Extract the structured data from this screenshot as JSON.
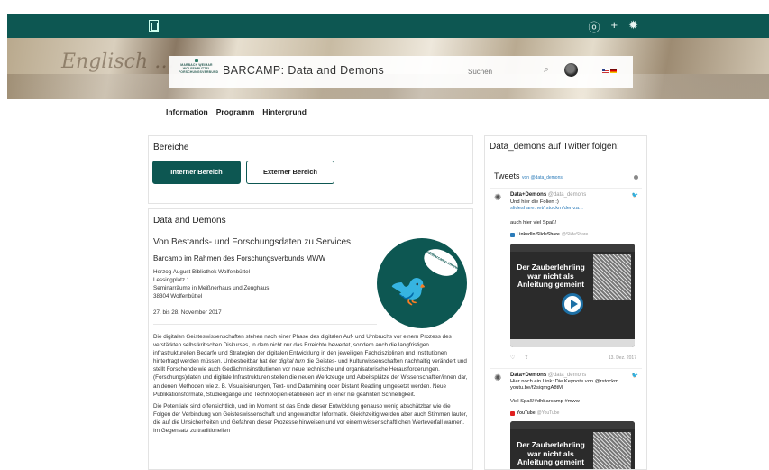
{
  "header": {
    "topbar_icons": [
      "ⓞ",
      "+",
      "✹"
    ],
    "logo_text": "MARBACH WEIMAR WOLFENBÜTTEL FORSCHUNGSVERBUND",
    "title": "BARCAMP: Data and Demons",
    "search_placeholder": "Suchen",
    "colors": {
      "brand": "#0d5752",
      "link": "#2b7bb9"
    }
  },
  "nav": [
    "Information",
    "Programm",
    "Hintergrund"
  ],
  "bereiche": {
    "heading": "Bereiche",
    "internal_button": "Interner Bereich",
    "external_button": "Externer Bereich"
  },
  "main": {
    "heading": "Data and Demons",
    "subheading": "Von Bestands- und Forschungsdaten zu Services",
    "event_line": "Barcamp im Rahmen des Forschungsverbunds MWW",
    "address": [
      "Herzog August Bibliothek Wolfenbüttel",
      "Lessingplatz 1",
      "Seminarräume in Meißnerhaus und Zeughaus",
      "38304 Wolfenbüttel"
    ],
    "date": "27. bis 28. November 2017",
    "logo_bubble": "#dhbarcamp #mww",
    "paragraph1_before": "Die digitalen Geisteswissenschaften stehen nach einer Phase des digitalen Auf- und Umbruchs vor einem Prozess des verstärkten selbstkritischen Diskurses, in dem nicht nur das Erreichte bewertet, sondern auch die langfristigen infrastrukturellen Bedarfe und Strategien der digitalen Entwicklung in den jeweiligen Fachdisziplinen und Institutionen hinterfragt werden müssen. Unbestreitbar hat der ",
    "paragraph1_em": "digital turn",
    "paragraph1_after": " die Geistes- und Kulturwissenschaften nachhaltig verändert und stellt Forschende wie auch Gedächtnisinstitutionen vor neue technische und organisatorische Herausforderungen. (Forschungs)daten und digitale Infrastrukturen stellen die neuen Werkzeuge und Arbeitsplätze der Wissenschaftler/innen dar, an denen Methoden wie z. B. Visualisierungen, Text- und Datamining oder Distant Reading umgesetzt werden. Neue Publikationsformate, Studiengänge und Technologien etablieren sich in einer nie geahnten Schnelligkeit.",
    "paragraph2": "Die Potentiale sind offensichtlich, und im Moment ist das Ende dieser Entwicklung genauso wenig abschätzbar wie die Folgen der Verbindung von Geisteswissenschaft und angewandter Informatik. Gleichzeitig werden aber auch Stimmen lauter, die auf die Unsicherheiten und Gefahren dieser Prozesse hinweisen und vor einem wissenschaftlichen Werteverfall warnen. Im Gegensatz zu traditionellen"
  },
  "twitter": {
    "heading": "Data_demons auf Twitter folgen!",
    "tweets_label": "Tweets",
    "tweets_by": "von @data_demons",
    "tweets": [
      {
        "name": "Data+Demons",
        "handle": "@data_demons",
        "line1": "Und hier die Folien :)",
        "link": "slideshare.net/rstockm/der-za...",
        "line2": "auch hier viel Spaß!",
        "source": "LinkedIn SlideShare",
        "source_handle": "@SlideShare",
        "card_title": "Der Zauberlehrling war nicht als Anleitung gemeint",
        "date": "13. Dez. 2017"
      },
      {
        "name": "Data+Demons",
        "handle": "@data_demons",
        "line1": "Hier noch ein Link: Die Keynote von @rstockm",
        "link": "youtu.be/fZsiqmgA8tM",
        "line2": "Viel Spaß!#dhbarcamp #mww",
        "source": "YouTube",
        "source_handle": "@YouTube",
        "card_title": "Der Zauberlehrling war nicht als Anleitung gemeint"
      }
    ]
  }
}
